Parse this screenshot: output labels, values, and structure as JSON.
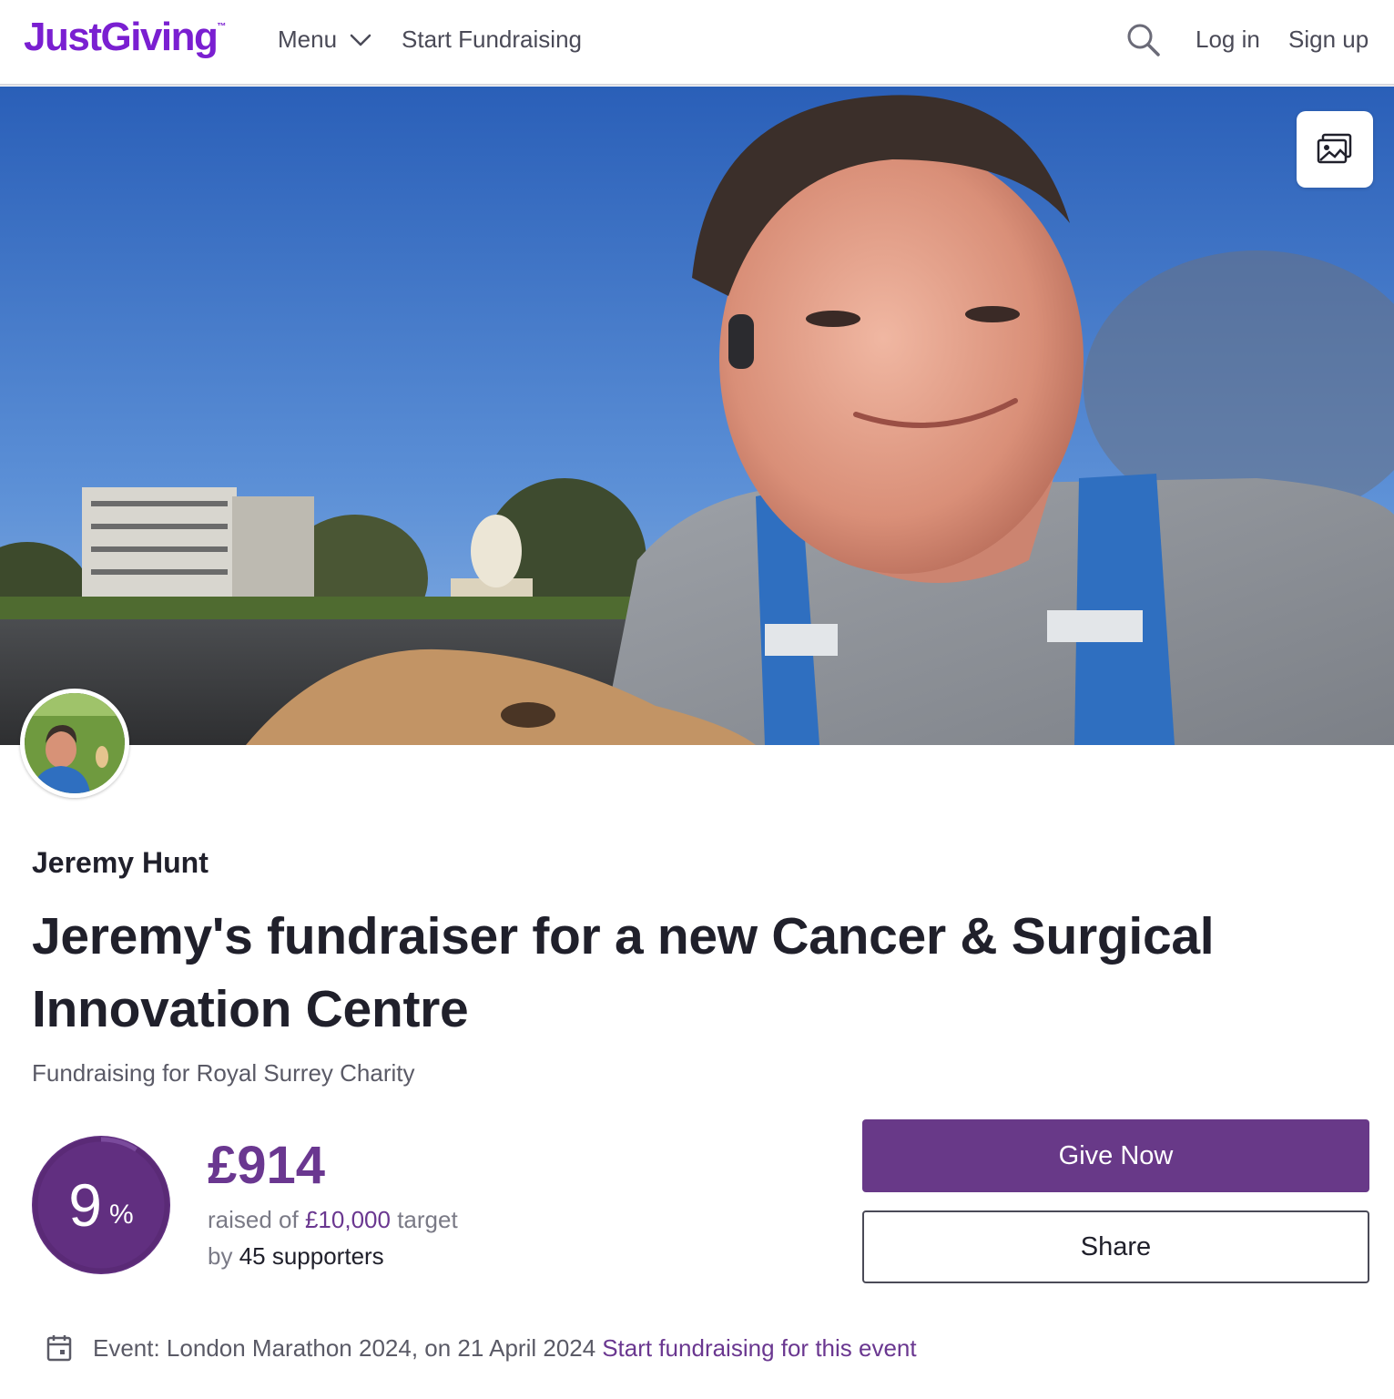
{
  "header": {
    "logo": "JustGiving",
    "logo_tm": "™",
    "menu_label": "Menu",
    "start_fundraising": "Start Fundraising",
    "login": "Log in",
    "signup": "Sign up"
  },
  "hero": {
    "icons": {
      "gallery": "image-gallery-icon"
    }
  },
  "fundraiser": {
    "name": "Jeremy Hunt",
    "title": "Jeremy's fundraiser for a new Cancer & Surgical Innovation Centre",
    "charity_line": "Fundraising for Royal Surrey Charity"
  },
  "progress": {
    "percent": "9",
    "percent_sign": "%",
    "fraction": 0.09,
    "raised": "£914",
    "raised_prefix": "raised of",
    "target": "£10,000",
    "target_suffix": "target",
    "by_prefix": "by",
    "supporters": "45 supporters"
  },
  "actions": {
    "give_now": "Give Now",
    "share": "Share"
  },
  "event": {
    "text": "Event: London Marathon 2024, on 21 April 2024",
    "link": "Start fundraising for this event"
  },
  "colors": {
    "brand_purple": "#7a1fd1",
    "button_purple": "#683988",
    "accent_purple": "#6a3790"
  }
}
